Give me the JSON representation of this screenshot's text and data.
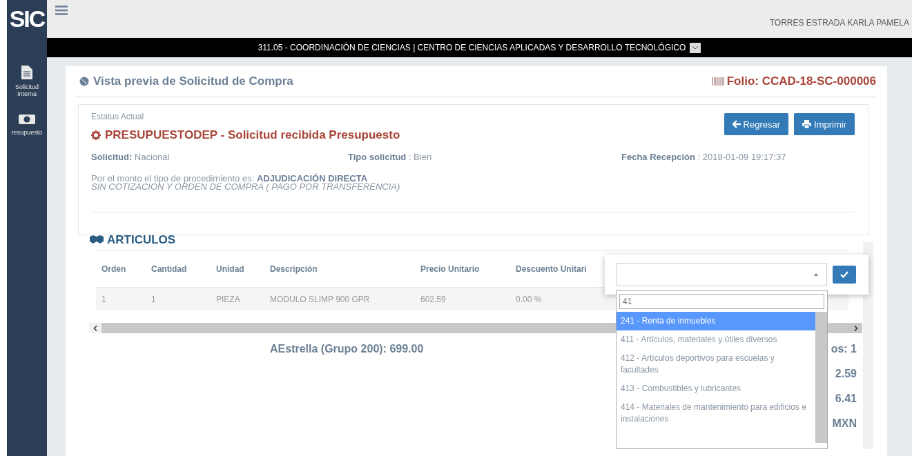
{
  "logo": "SIC",
  "user": "TORRES ESTRADA KARLA PAMELA",
  "unit_bar": {
    "text": "311.05 - COORDINACIÓN DE CIENCIAS | CENTRO DE CIENCIAS APLICADAS Y DESARROLLO TECNOLÓGICO"
  },
  "sidebar": {
    "items": [
      {
        "label": "Solicitud Interna"
      },
      {
        "label": "resupuesto"
      }
    ]
  },
  "page_title": "Vista previa de Solicitud de Compra",
  "folio": "Folio: CCAD-18-SC-000006",
  "status_label": "Estatus Actual",
  "status": "PRESUPUESTODEP - Solicitud recibida Presupuesto",
  "buttons": [
    {
      "label": "Regresar"
    },
    {
      "label": "Imprimir"
    }
  ],
  "fields": [
    {
      "label": "Solicitud:",
      "value": "Nacional"
    },
    {
      "label": "Tipo solicitud",
      "value": ": Bien"
    },
    {
      "label": "Fecha Recepción",
      "value": ": 2018-01-09 19:17:37"
    }
  ],
  "procedure": "Por el monto el tipo de procedimiento es: **ADJUDICACIÓN DIRECTA**",
  "procedure_note": "SIN COTIZACION Y ORDEN DE COMPRA ( PAGO POR TRANSFERENCIA)",
  "articles": {
    "title": "ARTICULOS",
    "columns": [
      "Orden",
      "Cantidad",
      "Unidad",
      "Descripción",
      "Precio Unitario",
      "Descuento Unitari"
    ],
    "rows": [
      [
        "1",
        "1",
        "PIEZA",
        "MODULO SLIMP 900 GPR",
        "602.59",
        "0.00 %"
      ]
    ]
  },
  "group_total": "AEstrella (Grupo 200): 699.00",
  "totals_partial": [
    "os: 1",
    "2.59",
    "6.41",
    "MXN"
  ],
  "popup": {
    "search": "41",
    "options": [
      {
        "label": "241 - Renta de inmuebles",
        "selected": true
      },
      {
        "label": "411 - Artículos, materiales y útiles diversos",
        "selected": false
      },
      {
        "label": "412 - Artículos deportivos para escuelas y facultades",
        "selected": false
      },
      {
        "label": "413 - Combustibles y lubricantes",
        "selected": false
      },
      {
        "label": "414 - Materiales de mantenimiento para edificios e instalaciones",
        "selected": false
      }
    ]
  }
}
